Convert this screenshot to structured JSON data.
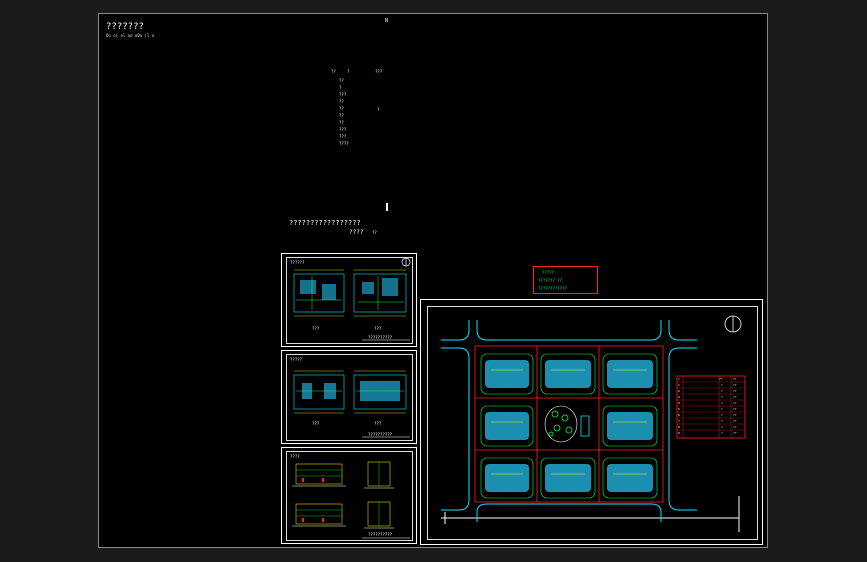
{
  "drawing": {
    "title": "???????",
    "subtitle": "Oo o( ol ao o0o (l o",
    "north_mark": "N",
    "index_header": [
      "??",
      "?",
      "???"
    ],
    "index_rows": [
      "??",
      "?",
      "???",
      "??",
      "??",
      "??",
      "??",
      "???",
      "???",
      "????"
    ],
    "index_side_mark": "?",
    "caption_line1": "?????????????????",
    "caption_line2": "????",
    "caption_line2_suffix": "??",
    "sheet1_title": "??????",
    "sheet1_label_left": "???",
    "sheet1_label_right": "???",
    "sheet1_footer": "??????????",
    "sheet2_title": "?????",
    "sheet2_label_left": "???",
    "sheet2_label_right": "???",
    "sheet2_footer": "??????????",
    "sheet3_title": "????",
    "sheet3_footer": "??????????",
    "legend_box_text": [
      "?????",
      "??????? ??",
      "????????????"
    ],
    "site_table_header": [
      "?",
      "??",
      "??"
    ],
    "site_table_rows": [
      [
        "1",
        "?",
        "??"
      ],
      [
        "2",
        "?",
        "??"
      ],
      [
        "3",
        "?",
        "??"
      ],
      [
        "4",
        "?",
        "??"
      ],
      [
        "5",
        "?",
        "??"
      ],
      [
        "6",
        "?",
        "??"
      ],
      [
        "7",
        "?",
        "??"
      ],
      [
        "8",
        "?",
        "??"
      ],
      [
        "9",
        "?",
        "??"
      ]
    ],
    "colors": {
      "background": "#000000",
      "outer": "#1b1b1b",
      "frame": "#ffffff",
      "red": "#ff2020",
      "cyan": "#00e5ff",
      "green": "#00ff40",
      "yellow": "#ffff00",
      "teal_fill": "#1a8fb0"
    },
    "icons": [
      "north-arrow-icon"
    ]
  }
}
